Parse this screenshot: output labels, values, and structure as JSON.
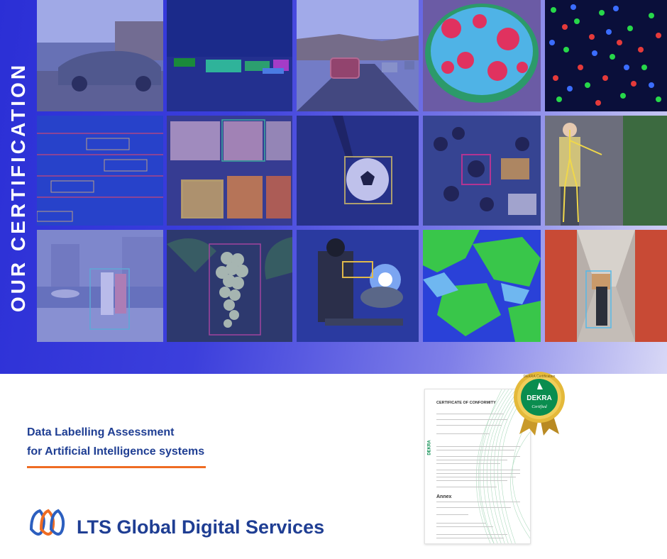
{
  "banner": {
    "vertical_title": "OUR CERTIFICATION",
    "background_colors": [
      "#2b2fd6",
      "#d8d8f6"
    ]
  },
  "tagline": {
    "line1": "Data Labelling Assessment",
    "line2": "for Artificial Intelligence systems"
  },
  "logo": {
    "name": "LTS Global Digital Services",
    "icon": "lts-logo-icon"
  },
  "certificate": {
    "title": "CERTIFICATE OF CONFORMITY",
    "brand": "DEKRA",
    "annex": "Annex",
    "seal_top": "DEKRA Certification",
    "seal_name": "DEKRA",
    "seal_bottom": "Certified"
  },
  "colors": {
    "brand_blue": "#1f3e93",
    "accent_orange": "#ef6c23",
    "dekra_green": "#0a8d4f",
    "seal_gold": "#e4b93a"
  }
}
